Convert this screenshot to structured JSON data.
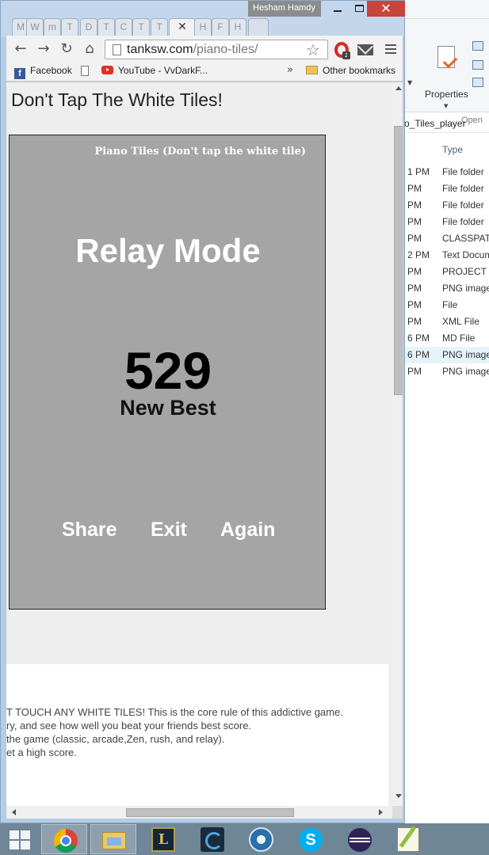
{
  "explorer": {
    "ribbon": {
      "properties_label": "Properties",
      "open_group_label": "Open"
    },
    "address_fragment": "o_Tiles_player",
    "column_type_header": "Type",
    "rows": [
      {
        "time": "1 PM",
        "type": "File folder"
      },
      {
        "time": "PM",
        "type": "File folder"
      },
      {
        "time": "PM",
        "type": "File folder"
      },
      {
        "time": "PM",
        "type": "File folder"
      },
      {
        "time": "PM",
        "type": "CLASSPATH"
      },
      {
        "time": "2 PM",
        "type": "Text Docum"
      },
      {
        "time": "PM",
        "type": "PROJECT Fi"
      },
      {
        "time": "PM",
        "type": "PNG image"
      },
      {
        "time": "PM",
        "type": "File"
      },
      {
        "time": "PM",
        "type": "XML File"
      },
      {
        "time": "6 PM",
        "type": "MD File"
      },
      {
        "time": "6 PM",
        "type": "PNG image"
      },
      {
        "time": "PM",
        "type": "PNG image"
      }
    ]
  },
  "browser": {
    "user_name": "Hesham Hamdy",
    "close_symbol": "✕",
    "tabs": [
      "M",
      "W",
      "m",
      "T",
      "D",
      "T",
      "C",
      "T",
      "H",
      "F",
      "H"
    ],
    "active_tab_close": "✕",
    "url_host": "tanksw.com",
    "url_path": "/piano-tiles/",
    "bookmarks": {
      "facebook": "Facebook",
      "youtube": "YouTube - VvDarkF...",
      "more": "»",
      "other": "Other bookmarks"
    }
  },
  "page": {
    "heading": "Don't Tap The White Tiles!",
    "game": {
      "title": "Piano Tiles (Don't tap the white tile)",
      "mode": "Relay Mode",
      "score": "529",
      "best_label": "New Best",
      "buttons": {
        "share": "Share",
        "exit": "Exit",
        "again": "Again"
      },
      "background_color": "#a5a5a5"
    },
    "description_lines": [
      "T TOUCH ANY WHITE TILES! This is the core rule of this addictive game.",
      "ry, and see how well you beat your friends best score.",
      " the game (classic, arcade,Zen, rush, and relay).",
      "et a high score."
    ]
  },
  "taskbar": {
    "items": [
      "windows-start",
      "chrome",
      "file-explorer",
      "league-of-legends",
      "blitz",
      "battle-net",
      "skype",
      "eclipse",
      "notepad-plus-plus"
    ],
    "skype_glyph": "S",
    "lol_glyph": "L"
  }
}
